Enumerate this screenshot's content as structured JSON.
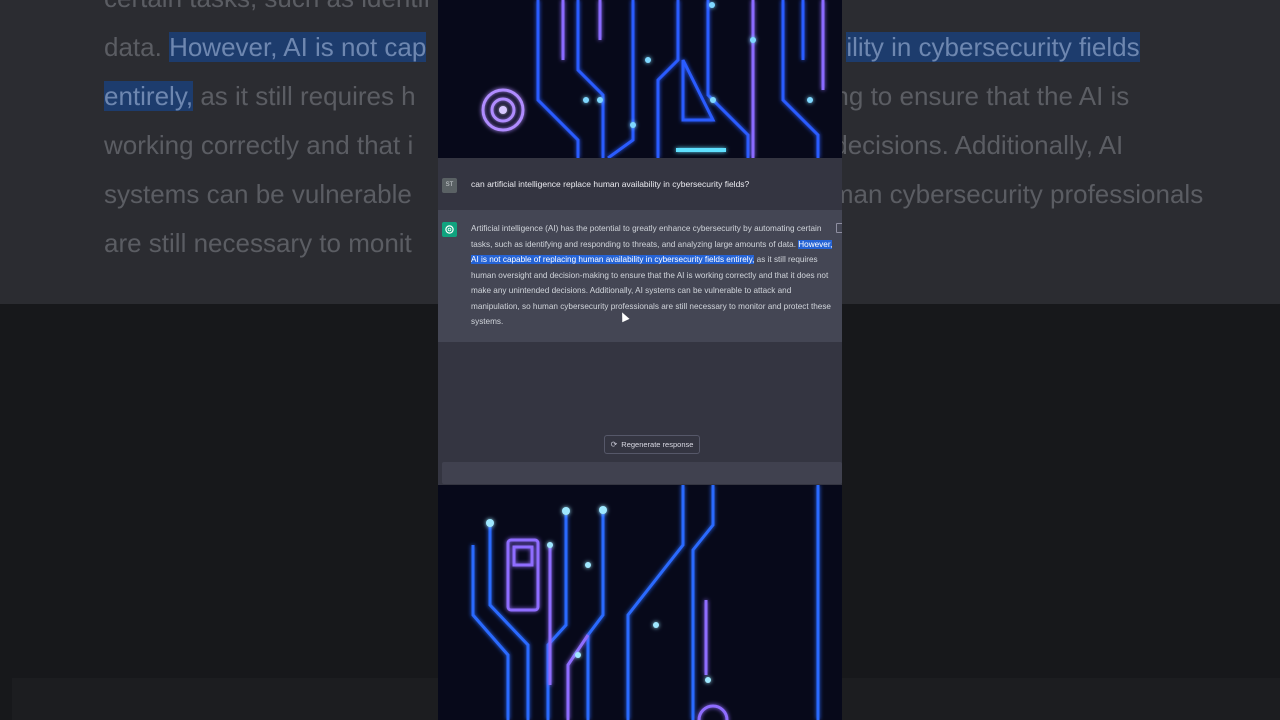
{
  "background": {
    "blurred_text_lines": [
      "certain tasks, such as identif",
      "data.",
      "However, AI is not cap",
      "ility in cybersecurity fields",
      "entirely,",
      "as it still requires h",
      "king to ensure that the AI is",
      "working correctly and that i",
      "decisions. Additionally, AI",
      "systems can be vulnerable",
      "man cybersecurity professionals",
      "are still necessary to monit"
    ]
  },
  "user": {
    "avatar_initials": "ST",
    "message": "can artificial intelligence replace human availability in cybersecurity fields?"
  },
  "assistant": {
    "pre_text": "Artificial intelligence (AI) has the potential to greatly enhance cybersecurity by automating certain tasks, such as identifying and responding to threats, and analyzing large amounts of data. ",
    "selected_text": "However, AI is not capable of replacing human availability in cybersecurity fields entirely,",
    "post_text": " as it still requires human oversight and decision-making to ensure that the AI is working correctly and that it does not make any unintended decisions. Additionally, AI systems can be vulnerable to attack and manipulation, so human cybersecurity professionals are still necessary to monitor and protect these systems."
  },
  "controls": {
    "regenerate_label": "Regenerate response",
    "regenerate_icon": "refresh-icon"
  },
  "colors": {
    "page_bg": "#343541",
    "assistant_bg": "#444654",
    "selection": "#2563d5",
    "bot_avatar": "#10a37f"
  }
}
